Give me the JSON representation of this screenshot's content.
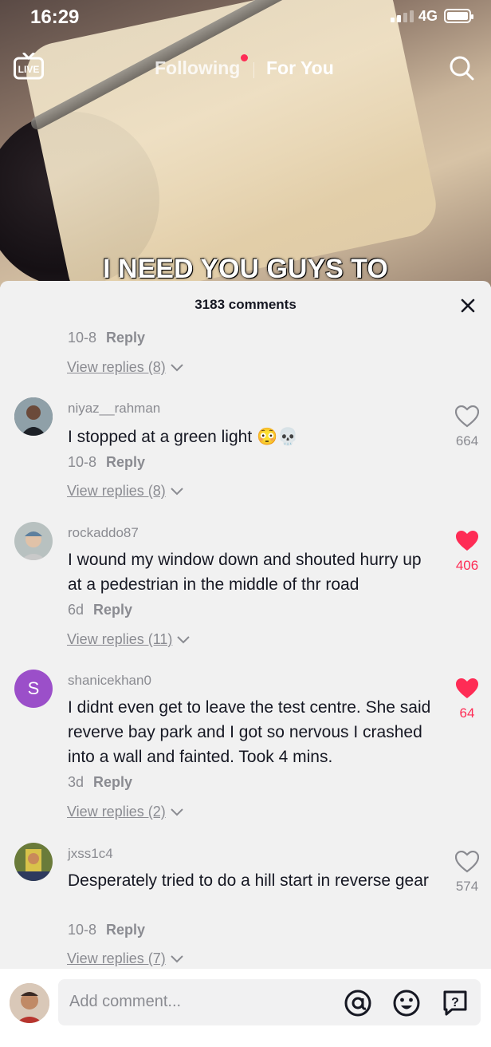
{
  "status": {
    "time": "16:29",
    "network": "4G"
  },
  "nav": {
    "live": "LIVE",
    "following": "Following",
    "for_you": "For You"
  },
  "video": {
    "caption": "I NEED YOU GUYS TO"
  },
  "comments_header": {
    "count_text": "3183 comments"
  },
  "first_partial": {
    "date": "10-8",
    "reply": "Reply",
    "view_replies": "View replies (8)"
  },
  "comments": [
    {
      "username": "niyaz__rahman",
      "text": "I stopped at a green light 😳💀",
      "date": "10-8",
      "reply": "Reply",
      "likes": "664",
      "liked": false,
      "view_replies": "View replies (8)"
    },
    {
      "username": "rockaddo87",
      "text": "I wound my window down and shouted hurry up at a pedestrian in the middle of thr road",
      "date": "6d",
      "reply": "Reply",
      "likes": "406",
      "liked": true,
      "view_replies": "View replies (11)"
    },
    {
      "username": "shanicekhan0",
      "avatar_letter": "S",
      "text": "I didnt even get to leave the test centre. She said reverve bay park and I got so nervous I crashed into a wall and fainted. Took 4 mins.",
      "date": "3d",
      "reply": "Reply",
      "likes": "64",
      "liked": true,
      "view_replies": "View replies (2)"
    },
    {
      "username": "jxss1c4",
      "text": "Desperately tried to do a hill start in reverse gear",
      "date": "10-8",
      "reply": "Reply",
      "likes": "574",
      "liked": false,
      "view_replies": "View replies (7)"
    }
  ],
  "composer": {
    "placeholder": "Add comment..."
  },
  "colors": {
    "accent": "#fe2c55",
    "avatar_s": "#9b4fc9",
    "sheet_bg": "#f1f1f1"
  }
}
